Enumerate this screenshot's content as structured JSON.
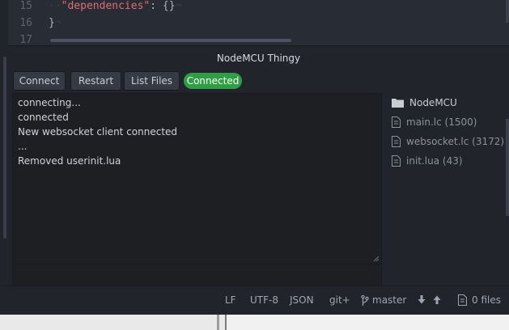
{
  "editor": {
    "lines": [
      {
        "num": "15",
        "key": "\"dependencies\"",
        "rest": ": {}"
      },
      {
        "num": "16",
        "text": "}"
      },
      {
        "num": "17",
        "text": ""
      }
    ]
  },
  "panel": {
    "title": "NodeMCU Thingy",
    "buttons": {
      "connect": "Connect",
      "restart": "Restart",
      "list_files": "List Files"
    },
    "status": "Connected",
    "status_color": "#2e9f45",
    "console_lines": [
      "connecting...",
      "connected",
      "New websocket client connected",
      "...",
      "Removed userinit.lua"
    ],
    "console_input_value": "",
    "file_tree": {
      "root": "NodeMCU",
      "files": [
        {
          "name": "main.lc (1500)"
        },
        {
          "name": "websocket.lc (3172)"
        },
        {
          "name": "init.lua (43)"
        }
      ]
    }
  },
  "status_bar": {
    "line_ending": "LF",
    "encoding": "UTF-8",
    "grammar": "JSON",
    "git": "git+",
    "branch": "master",
    "files": "0 files"
  }
}
